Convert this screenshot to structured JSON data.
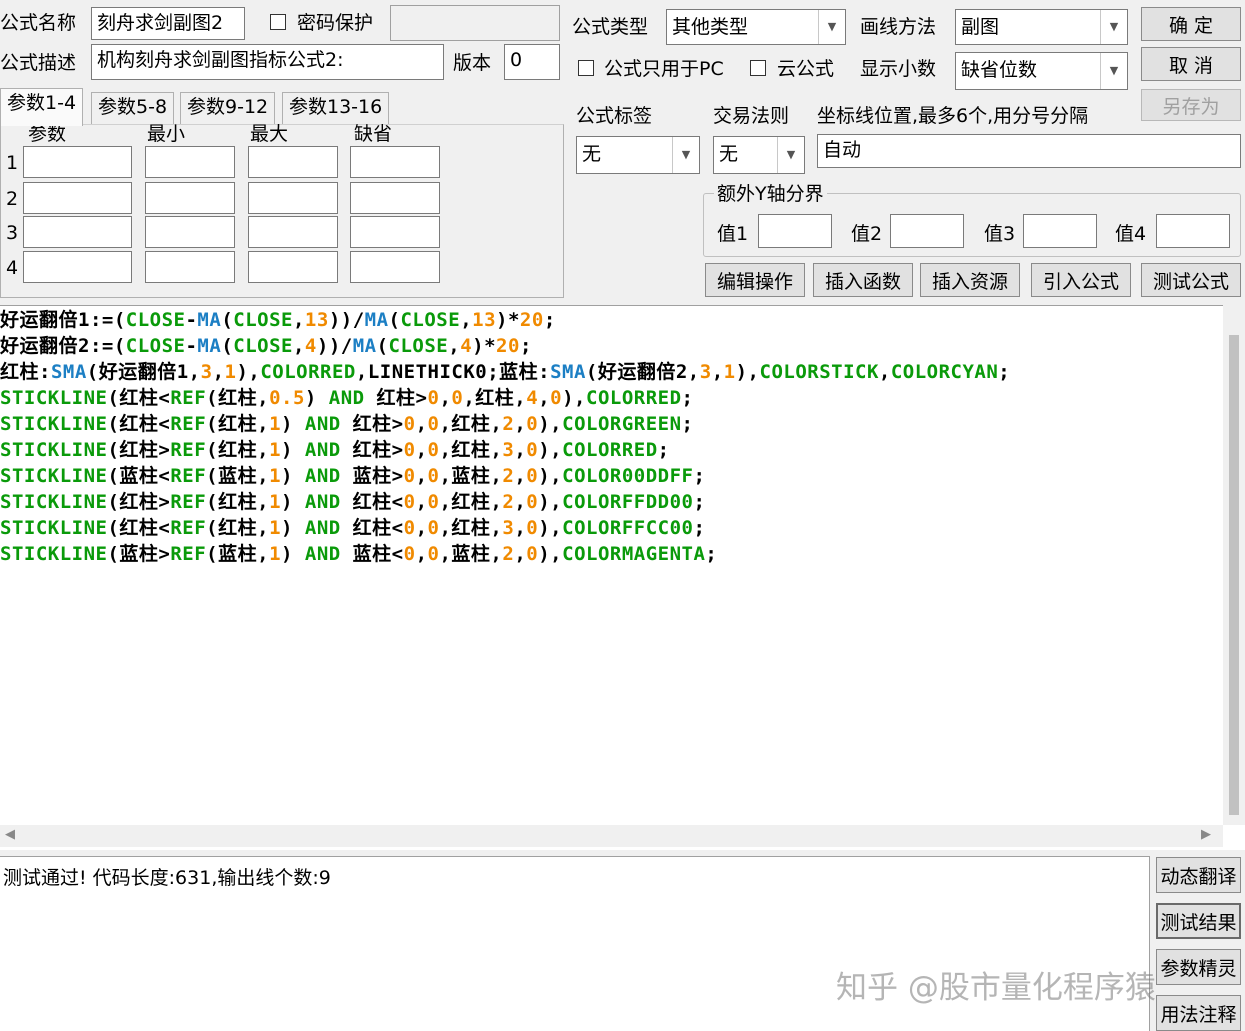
{
  "header": {
    "name_label": "公式名称",
    "name_value": "刻舟求剑副图2",
    "password_label": "密码保护",
    "desc_label": "公式描述",
    "desc_value": "机构刻舟求剑副图指标公式2:",
    "version_label": "版本",
    "version_value": "0",
    "type_label": "公式类型",
    "type_value": "其他类型",
    "draw_label": "画线方法",
    "draw_value": "副图",
    "pc_only_label": "公式只用于PC",
    "cloud_label": "云公式",
    "decimals_label": "显示小数",
    "decimals_value": "缺省位数",
    "ok_button": "确  定",
    "cancel_button": "取  消",
    "saveas_button": "另存为"
  },
  "tabs": [
    "参数1-4",
    "参数5-8",
    "参数9-12",
    "参数13-16"
  ],
  "params": {
    "headers": [
      "参数",
      "最小",
      "最大",
      "缺省"
    ],
    "rows": [
      "1",
      "2",
      "3",
      "4"
    ]
  },
  "right_panel": {
    "tag_label": "公式标签",
    "tag_value": "无",
    "rule_label": "交易法则",
    "rule_value": "无",
    "axis_label": "坐标线位置,最多6个,用分号分隔",
    "axis_value": "自动",
    "yaxis_group": "额外Y轴分界",
    "v1": "值1",
    "v2": "值2",
    "v3": "值3",
    "v4": "值4"
  },
  "actions": [
    "编辑操作",
    "插入函数",
    "插入资源",
    "引入公式",
    "测试公式"
  ],
  "code_lines": [
    [
      [
        "好运翻倍1:=(",
        "#000"
      ],
      [
        "CLOSE",
        "#0a9a0a"
      ],
      [
        "-",
        "#000"
      ],
      [
        "MA",
        "#1c7fc4"
      ],
      [
        "(",
        "#000"
      ],
      [
        "CLOSE",
        "#0a9a0a"
      ],
      [
        ",",
        "#000"
      ],
      [
        "13",
        "#f08a00"
      ],
      [
        "))/",
        "#000"
      ],
      [
        "MA",
        "#1c7fc4"
      ],
      [
        "(",
        "#000"
      ],
      [
        "CLOSE",
        "#0a9a0a"
      ],
      [
        ",",
        "#000"
      ],
      [
        "13",
        "#f08a00"
      ],
      [
        ")*",
        "#000"
      ],
      [
        "20",
        "#f08a00"
      ],
      [
        ";",
        "#000"
      ]
    ],
    [
      [
        "好运翻倍2:=(",
        "#000"
      ],
      [
        "CLOSE",
        "#0a9a0a"
      ],
      [
        "-",
        "#000"
      ],
      [
        "MA",
        "#1c7fc4"
      ],
      [
        "(",
        "#000"
      ],
      [
        "CLOSE",
        "#0a9a0a"
      ],
      [
        ",",
        "#000"
      ],
      [
        "4",
        "#f08a00"
      ],
      [
        "))/",
        "#000"
      ],
      [
        "MA",
        "#1c7fc4"
      ],
      [
        "(",
        "#000"
      ],
      [
        "CLOSE",
        "#0a9a0a"
      ],
      [
        ",",
        "#000"
      ],
      [
        "4",
        "#f08a00"
      ],
      [
        ")*",
        "#000"
      ],
      [
        "20",
        "#f08a00"
      ],
      [
        ";",
        "#000"
      ]
    ],
    [
      [
        "红柱:",
        "#000"
      ],
      [
        "SMA",
        "#1c7fc4"
      ],
      [
        "(好运翻倍1,",
        "#000"
      ],
      [
        "3",
        "#f08a00"
      ],
      [
        ",",
        "#000"
      ],
      [
        "1",
        "#f08a00"
      ],
      [
        "),",
        "#000"
      ],
      [
        "COLORRED",
        "#0a9a0a"
      ],
      [
        ",LINETHICK0;蓝柱:",
        "#000"
      ],
      [
        "SMA",
        "#1c7fc4"
      ],
      [
        "(好运翻倍2,",
        "#000"
      ],
      [
        "3",
        "#f08a00"
      ],
      [
        ",",
        "#000"
      ],
      [
        "1",
        "#f08a00"
      ],
      [
        "),",
        "#000"
      ],
      [
        "COLORSTICK",
        "#0a9a0a"
      ],
      [
        ",",
        "#000"
      ],
      [
        "COLORCYAN",
        "#0a9a0a"
      ],
      [
        ";",
        "#000"
      ]
    ],
    [
      [
        "STICKLINE",
        "#0a9a0a"
      ],
      [
        "(红柱<",
        "#000"
      ],
      [
        "REF",
        "#0a9a0a"
      ],
      [
        "(红柱,",
        "#000"
      ],
      [
        "0.5",
        "#f08a00"
      ],
      [
        ") ",
        "#000"
      ],
      [
        "AND",
        "#0a9a0a"
      ],
      [
        " 红柱>",
        "#000"
      ],
      [
        "0",
        "#f08a00"
      ],
      [
        ",",
        "#000"
      ],
      [
        "0",
        "#f08a00"
      ],
      [
        ",红柱,",
        "#000"
      ],
      [
        "4",
        "#f08a00"
      ],
      [
        ",",
        "#000"
      ],
      [
        "0",
        "#f08a00"
      ],
      [
        "),",
        "#000"
      ],
      [
        "COLORRED",
        "#0a9a0a"
      ],
      [
        ";",
        "#000"
      ]
    ],
    [
      [
        "STICKLINE",
        "#0a9a0a"
      ],
      [
        "(红柱<",
        "#000"
      ],
      [
        "REF",
        "#0a9a0a"
      ],
      [
        "(红柱,",
        "#000"
      ],
      [
        "1",
        "#f08a00"
      ],
      [
        ") ",
        "#000"
      ],
      [
        "AND",
        "#0a9a0a"
      ],
      [
        " 红柱>",
        "#000"
      ],
      [
        "0",
        "#f08a00"
      ],
      [
        ",",
        "#000"
      ],
      [
        "0",
        "#f08a00"
      ],
      [
        ",红柱,",
        "#000"
      ],
      [
        "2",
        "#f08a00"
      ],
      [
        ",",
        "#000"
      ],
      [
        "0",
        "#f08a00"
      ],
      [
        "),",
        "#000"
      ],
      [
        "COLORGREEN",
        "#0a9a0a"
      ],
      [
        ";",
        "#000"
      ]
    ],
    [
      [
        "STICKLINE",
        "#0a9a0a"
      ],
      [
        "(红柱>",
        "#000"
      ],
      [
        "REF",
        "#0a9a0a"
      ],
      [
        "(红柱,",
        "#000"
      ],
      [
        "1",
        "#f08a00"
      ],
      [
        ") ",
        "#000"
      ],
      [
        "AND",
        "#0a9a0a"
      ],
      [
        " 红柱>",
        "#000"
      ],
      [
        "0",
        "#f08a00"
      ],
      [
        ",",
        "#000"
      ],
      [
        "0",
        "#f08a00"
      ],
      [
        ",红柱,",
        "#000"
      ],
      [
        "3",
        "#f08a00"
      ],
      [
        ",",
        "#000"
      ],
      [
        "0",
        "#f08a00"
      ],
      [
        "),",
        "#000"
      ],
      [
        "COLORRED",
        "#0a9a0a"
      ],
      [
        ";",
        "#000"
      ]
    ],
    [
      [
        "STICKLINE",
        "#0a9a0a"
      ],
      [
        "(蓝柱<",
        "#000"
      ],
      [
        "REF",
        "#0a9a0a"
      ],
      [
        "(蓝柱,",
        "#000"
      ],
      [
        "1",
        "#f08a00"
      ],
      [
        ") ",
        "#000"
      ],
      [
        "AND",
        "#0a9a0a"
      ],
      [
        " 蓝柱>",
        "#000"
      ],
      [
        "0",
        "#f08a00"
      ],
      [
        ",",
        "#000"
      ],
      [
        "0",
        "#f08a00"
      ],
      [
        ",蓝柱,",
        "#000"
      ],
      [
        "2",
        "#f08a00"
      ],
      [
        ",",
        "#000"
      ],
      [
        "0",
        "#f08a00"
      ],
      [
        "),",
        "#000"
      ],
      [
        "COLOR00DDFF",
        "#0a9a0a"
      ],
      [
        ";",
        "#000"
      ]
    ],
    [
      [
        "STICKLINE",
        "#0a9a0a"
      ],
      [
        "(红柱>",
        "#000"
      ],
      [
        "REF",
        "#0a9a0a"
      ],
      [
        "(红柱,",
        "#000"
      ],
      [
        "1",
        "#f08a00"
      ],
      [
        ") ",
        "#000"
      ],
      [
        "AND",
        "#0a9a0a"
      ],
      [
        " 红柱<",
        "#000"
      ],
      [
        "0",
        "#f08a00"
      ],
      [
        ",",
        "#000"
      ],
      [
        "0",
        "#f08a00"
      ],
      [
        ",红柱,",
        "#000"
      ],
      [
        "2",
        "#f08a00"
      ],
      [
        ",",
        "#000"
      ],
      [
        "0",
        "#f08a00"
      ],
      [
        "),",
        "#000"
      ],
      [
        "COLORFFDD00",
        "#0a9a0a"
      ],
      [
        ";",
        "#000"
      ]
    ],
    [
      [
        "STICKLINE",
        "#0a9a0a"
      ],
      [
        "(红柱<",
        "#000"
      ],
      [
        "REF",
        "#0a9a0a"
      ],
      [
        "(红柱,",
        "#000"
      ],
      [
        "1",
        "#f08a00"
      ],
      [
        ") ",
        "#000"
      ],
      [
        "AND",
        "#0a9a0a"
      ],
      [
        " 红柱<",
        "#000"
      ],
      [
        "0",
        "#f08a00"
      ],
      [
        ",",
        "#000"
      ],
      [
        "0",
        "#f08a00"
      ],
      [
        ",红柱,",
        "#000"
      ],
      [
        "3",
        "#f08a00"
      ],
      [
        ",",
        "#000"
      ],
      [
        "0",
        "#f08a00"
      ],
      [
        "),",
        "#000"
      ],
      [
        "COLORFFCC00",
        "#0a9a0a"
      ],
      [
        ";",
        "#000"
      ]
    ],
    [
      [
        "STICKLINE",
        "#0a9a0a"
      ],
      [
        "(蓝柱>",
        "#000"
      ],
      [
        "REF",
        "#0a9a0a"
      ],
      [
        "(蓝柱,",
        "#000"
      ],
      [
        "1",
        "#f08a00"
      ],
      [
        ") ",
        "#000"
      ],
      [
        "AND",
        "#0a9a0a"
      ],
      [
        " 蓝柱<",
        "#000"
      ],
      [
        "0",
        "#f08a00"
      ],
      [
        ",",
        "#000"
      ],
      [
        "0",
        "#f08a00"
      ],
      [
        ",蓝柱,",
        "#000"
      ],
      [
        "2",
        "#f08a00"
      ],
      [
        ",",
        "#000"
      ],
      [
        "0",
        "#f08a00"
      ],
      [
        "),",
        "#000"
      ],
      [
        "COLORMAGENTA",
        "#0a9a0a"
      ],
      [
        ";",
        "#000"
      ]
    ]
  ],
  "output_text": "测试通过! 代码长度:631,输出线个数:9",
  "side_buttons": [
    "动态翻译",
    "测试结果",
    "参数精灵",
    "用法注释"
  ],
  "watermark": "知乎 @股市量化程序猿"
}
